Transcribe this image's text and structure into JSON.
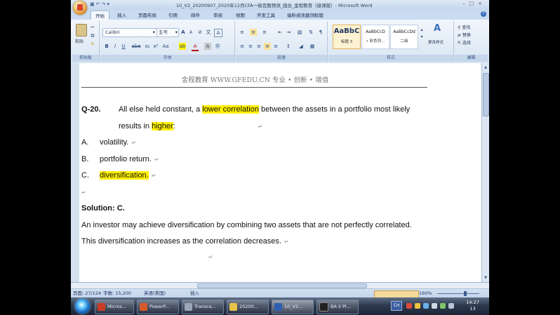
{
  "window": {
    "title": "10_V2_20200907_2020年12月CFA一级百题预测_组合_金程教育（接课版）- Microsoft Word",
    "controls": [
      "–",
      "□",
      "×"
    ]
  },
  "qat": [
    "save-icon",
    "undo-icon",
    "redo-icon",
    "dropdown-icon"
  ],
  "tabs": [
    {
      "label": "开始"
    },
    {
      "label": "插入"
    },
    {
      "label": "页面布局"
    },
    {
      "label": "引用"
    },
    {
      "label": "邮件"
    },
    {
      "label": "审阅"
    },
    {
      "label": "视图"
    },
    {
      "label": "开发工具"
    },
    {
      "label": "福昕阅读器领鲜版"
    }
  ],
  "ribbon": {
    "clipboard": {
      "label": "剪贴板",
      "paste": "粘贴"
    },
    "font": {
      "label": "字体",
      "name": "Calibri",
      "size": "五号"
    },
    "paragraph": {
      "label": "段落"
    },
    "styles": {
      "label": "样式",
      "items": [
        {
          "sample": "AaBbC",
          "name": "标题 3"
        },
        {
          "sample": "AaBbCcD",
          "name": "• 彩色列..."
        },
        {
          "sample": "AaBbCcDd",
          "name": "二级"
        }
      ],
      "change_styles": "更改样式"
    },
    "editing": {
      "label": "编辑",
      "find": "查找",
      "replace": "替换",
      "select": "选择"
    }
  },
  "document": {
    "header": "金程教育 WWW.GFEDU.CN 专业 • 创新 • 增值",
    "question_number": "Q-20.",
    "question_pre": "All else held constant, a ",
    "question_hl1": "lower correlation",
    "question_mid": " between the assets in a portfolio most likely",
    "question_line2_pre": "results in ",
    "question_hl2": "higher",
    "question_line2_post": ":",
    "options": [
      {
        "letter": "A.",
        "text": "volatility."
      },
      {
        "letter": "B.",
        "text": "portfolio return."
      },
      {
        "letter": "C.",
        "text": "diversification."
      }
    ],
    "solution_label": "Solution: C.",
    "explanation_1": "An investor may achieve diversification by combining two assets that are not perfectly correlated.",
    "explanation_2": "This diversification increases as the correlation decreases."
  },
  "status": {
    "page": "页面: 27/124",
    "words": "字数: 15,200",
    "language": "英语(美国)",
    "insert": "插入",
    "zoom": "160%"
  },
  "taskbar": {
    "items": [
      {
        "label": "Micros...",
        "color": "#c83b24"
      },
      {
        "label": "PowerP...",
        "color": "#d35a2a"
      },
      {
        "label": "Transce...",
        "color": "#9aa6b5"
      },
      {
        "label": "20200...",
        "color": "#e9c24a"
      },
      {
        "label": "10_V2...",
        "color": "#2d5fb0"
      },
      {
        "label": "BA II Pl...",
        "color": "#222"
      }
    ],
    "lang": "CH",
    "time": "14:27",
    "date": "13"
  }
}
